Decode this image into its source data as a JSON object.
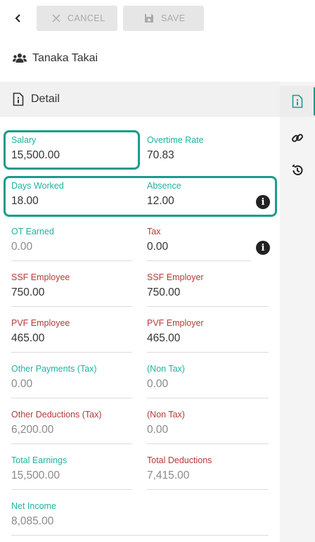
{
  "toolbar": {
    "cancel_label": "CANCEL",
    "save_label": "SAVE"
  },
  "user": {
    "name": "Tanaka Takai"
  },
  "section": {
    "title": "Detail"
  },
  "fields": {
    "salary": {
      "label": "Salary",
      "value": "15,500.00"
    },
    "overtime_rate": {
      "label": "Overtime Rate",
      "value": "70.83"
    },
    "days_worked": {
      "label": "Days Worked",
      "value": "18.00"
    },
    "absence": {
      "label": "Absence",
      "value": "12.00"
    },
    "ot_earned": {
      "label": "OT Earned",
      "value": "0.00"
    },
    "tax": {
      "label": "Tax",
      "value": "0.00"
    },
    "ssf_employee": {
      "label": "SSF Employee",
      "value": "750.00"
    },
    "ssf_employer": {
      "label": "SSF Employer",
      "value": "750.00"
    },
    "pvf_employee": {
      "label": "PVF Employee",
      "value": "465.00"
    },
    "pvf_employer": {
      "label": "PVF Employer",
      "value": "465.00"
    },
    "other_payments_tax": {
      "label": "Other Payments (Tax)",
      "value": "0.00"
    },
    "other_payments_non_tax": {
      "label": "(Non Tax)",
      "value": "0.00"
    },
    "other_deductions_tax": {
      "label": "Other Deductions (Tax)",
      "value": "6,200.00"
    },
    "other_deductions_non_tax": {
      "label": "(Non Tax)",
      "value": "0.00"
    },
    "total_earnings": {
      "label": "Total Earnings",
      "value": "15,500.00"
    },
    "total_deductions": {
      "label": "Total Deductions",
      "value": "7,415.00"
    },
    "net_income": {
      "label": "Net Income",
      "value": "8,085.00"
    }
  },
  "colors": {
    "accent": "#1a9c8c",
    "label_teal": "#1fb3a0",
    "label_red": "#b43a3a"
  },
  "icons": {
    "back": "chevron-left-icon",
    "cancel": "close-icon",
    "save": "floppy-disk-icon",
    "user": "users-icon",
    "detail": "info-document-icon",
    "link": "link-icon",
    "history": "history-icon",
    "info": "info-circle-icon"
  }
}
